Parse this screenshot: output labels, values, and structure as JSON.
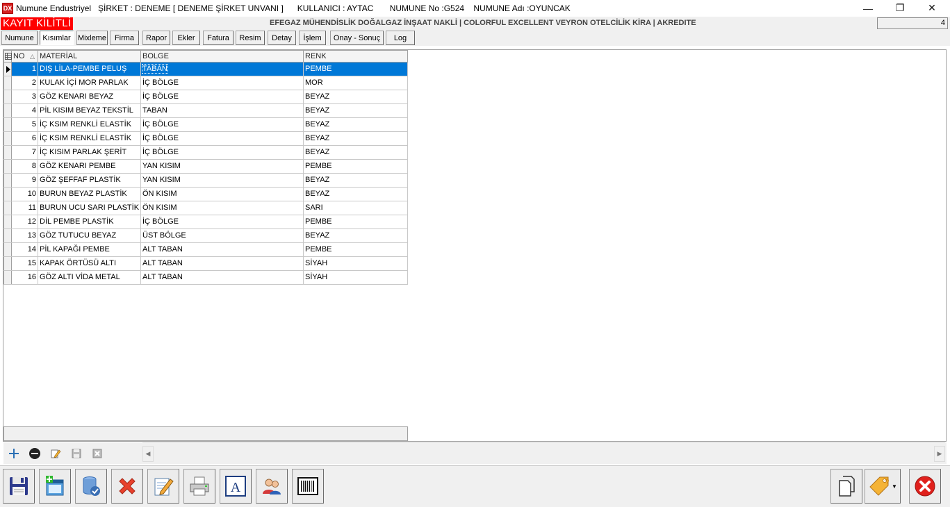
{
  "titlebar": {
    "app_icon_text": "DX",
    "title": "Numune Endustriyel   ŞİRKET : DENEME [ DENEME ŞİRKET UNVANI ]      KULLANICI : AYTAC       NUMUNE No :G524    NUMUNE Adı :OYUNCAK",
    "minimize": "—",
    "restore": "❐",
    "close": "✕"
  },
  "infobar": {
    "lock_label": "KAYIT KİLİTLİ",
    "company_line": "EFEGAZ MÜHENDİSLİK DOĞALGAZ İNŞAAT NAKLİ | COLORFUL EXCELLENT VEYRON OTELCİLİK KİRA | AKREDITE",
    "counter": "4"
  },
  "tabs": [
    {
      "label": "Numune"
    },
    {
      "label": "Kısımlar"
    },
    {
      "label": "Mixleme"
    },
    {
      "label": "Firma"
    },
    {
      "label": "Rapor"
    },
    {
      "label": "Ekler"
    },
    {
      "label": "Fatura"
    },
    {
      "label": "Resim"
    },
    {
      "label": "Detay"
    },
    {
      "label": "İşlem"
    },
    {
      "label": "Onay - Sonuç"
    },
    {
      "label": "Log"
    }
  ],
  "active_tab": "Kısımlar",
  "grid": {
    "headers": {
      "no": "NO",
      "sort_icon": "△",
      "material": "MATERİAL",
      "bolge": "BOLGE",
      "renk": "RENK"
    },
    "rows": [
      {
        "no": "1",
        "material": "DIŞ LİLA-PEMBE PELUŞ",
        "bolge": "TABAN",
        "renk": "PEMBE"
      },
      {
        "no": "2",
        "material": "KULAK İÇİ MOR PARLAK",
        "bolge": "İÇ BÖLGE",
        "renk": "MOR"
      },
      {
        "no": "3",
        "material": "GÖZ KENARI BEYAZ",
        "bolge": "İÇ BÖLGE",
        "renk": "BEYAZ"
      },
      {
        "no": "4",
        "material": "PİL KISIM BEYAZ TEKSTİL",
        "bolge": "TABAN",
        "renk": "BEYAZ"
      },
      {
        "no": "5",
        "material": "İÇ KSIM RENKLİ ELASTİK",
        "bolge": "İÇ BÖLGE",
        "renk": "BEYAZ"
      },
      {
        "no": "6",
        "material": "İÇ KSIM RENKLİ ELASTİK",
        "bolge": "İÇ BÖLGE",
        "renk": "BEYAZ"
      },
      {
        "no": "7",
        "material": "İÇ KISIM PARLAK ŞERİT",
        "bolge": "İÇ BÖLGE",
        "renk": "BEYAZ"
      },
      {
        "no": "8",
        "material": "GÖZ KENARI PEMBE",
        "bolge": "YAN KISIM",
        "renk": "PEMBE"
      },
      {
        "no": "9",
        "material": "GÖZ ŞEFFAF PLASTİK",
        "bolge": "YAN KISIM",
        "renk": "BEYAZ"
      },
      {
        "no": "10",
        "material": "BURUN BEYAZ PLASTİK",
        "bolge": "ÖN KISIM",
        "renk": "BEYAZ"
      },
      {
        "no": "11",
        "material": "BURUN UCU SARI PLASTİK",
        "bolge": "ÖN KISIM",
        "renk": "SARI"
      },
      {
        "no": "12",
        "material": "DİL PEMBE PLASTİK",
        "bolge": "İÇ BÖLGE",
        "renk": "PEMBE"
      },
      {
        "no": "13",
        "material": "GÖZ TUTUCU BEYAZ",
        "bolge": "ÜST BÖLGE",
        "renk": "BEYAZ"
      },
      {
        "no": "14",
        "material": "PİL KAPAĞI PEMBE",
        "bolge": "ALT TABAN",
        "renk": "PEMBE"
      },
      {
        "no": "15",
        "material": "KAPAK ÖRTÜSÜ ALTI",
        "bolge": "ALT TABAN",
        "renk": "SİYAH"
      },
      {
        "no": "16",
        "material": "GÖZ ALTI VİDA METAL",
        "bolge": "ALT TABAN",
        "renk": "SİYAH"
      }
    ]
  },
  "colors": {
    "selection": "#0078d7",
    "lock_bg": "#ff0000",
    "close_red": "#e0201c"
  },
  "navigator_icons": [
    "plus-icon",
    "minus-icon",
    "edit-icon",
    "save-icon",
    "cancel-icon"
  ],
  "toolbar_icons": [
    "save-disk-icon",
    "new-window-icon",
    "delete-record-icon",
    "red-x-icon",
    "edit-notepad-icon",
    "printer-icon",
    "text-a-icon",
    "users-icon",
    "barcode-icon",
    "copy-pages-icon",
    "tag-icon",
    "exit-icon"
  ],
  "text_icon_glyph": "A"
}
